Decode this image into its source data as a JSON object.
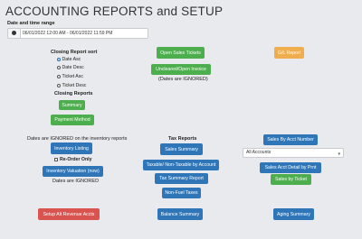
{
  "title": "ACCOUNTING REPORTS and SETUP",
  "date_range": {
    "label": "Date and time range",
    "value": "06/01/2022 12:00 AM - 06/01/2022 11:59 PM"
  },
  "closing_sort": {
    "heading": "Closing Report sort",
    "options": [
      "Date Asc",
      "Date Desc",
      "Ticket Asc",
      "Ticket Desc"
    ],
    "selected": "Date Asc"
  },
  "closing_reports": {
    "heading": "Closing Reports",
    "summary": "Summary",
    "payment_method": "Payment Method"
  },
  "tickets": {
    "open_sales": "Open Sales Tickets",
    "unclosed_open_invoice": "Uncleared/Open Invoice",
    "ignored_note": "(Dates are IGNORED)"
  },
  "gl_report": "G/L Report",
  "inventory": {
    "note": "Dates are IGNORED on the inventory reports",
    "listing": "Inventory Listing",
    "reorder_label": "Re-Order Only",
    "valuation": "Inventory Valuation (now)",
    "ignored_note": "Dates are IGNORED"
  },
  "tax_reports": {
    "heading": "Tax Reports",
    "sales_summary": "Sales Summary",
    "taxable_nontaxable": "Taxable/ Non-Taxable by Account",
    "tax_summary": "Tax Summary Report",
    "non_fuel_taxes": "Non-Fuel Taxes"
  },
  "accounts": {
    "sales_by_acct_number": "Sales By Acct Number",
    "account_select": "All Accounts",
    "sales_acct_detail": "Sales Acct Detail by Prnt",
    "sales_by_ticket": "Sales by Ticket"
  },
  "bottom": {
    "setup_alt_revenue": "Setup Alt Revenue Accts",
    "balance_summary": "Balance Summary",
    "aging_summary": "Aging Summary"
  }
}
